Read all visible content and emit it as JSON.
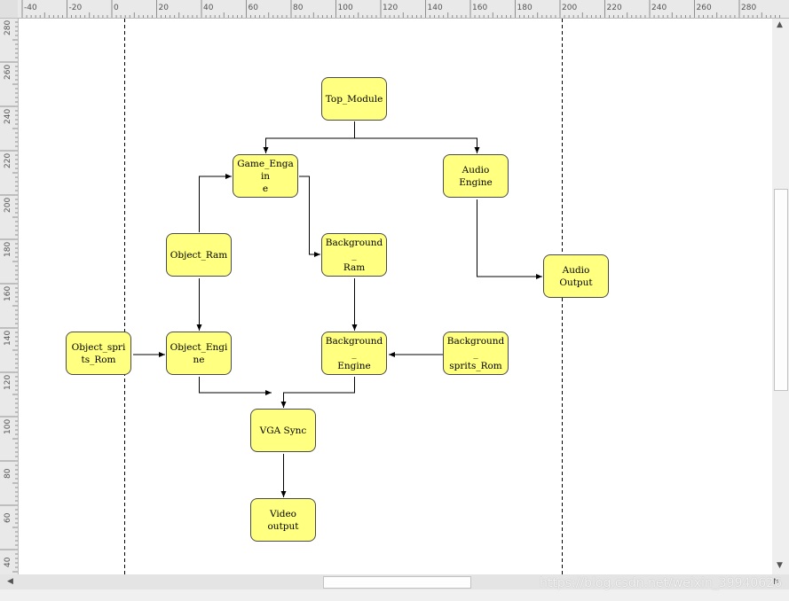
{
  "nodes": {
    "top_module": "Top_Module",
    "game_engine": "Game_Engain\ne",
    "audio_engine": "Audio\nEngine",
    "object_ram": "Object_Ram",
    "background_ram": "Background_\nRam",
    "audio_output": "Audio\nOutput",
    "object_sprits_rom": "Object_spri\nts_Rom",
    "object_engine": "Object_Engi\nne",
    "background_engine": "Background_\nEngine",
    "background_sprits_rom": "Background_\nsprits_Rom",
    "vga_sync": "VGA Sync",
    "video_output": "Video\noutput"
  },
  "rulers": {
    "horizontal_labels": [
      "-40",
      "-20",
      "0",
      "20",
      "40",
      "60",
      "80",
      "100",
      "120",
      "140",
      "160",
      "180",
      "200",
      "220",
      "240",
      "260",
      "280"
    ],
    "vertical_labels": [
      "280",
      "260",
      "240",
      "220",
      "200",
      "180",
      "160",
      "140",
      "120",
      "100",
      "80",
      "60",
      "40"
    ]
  },
  "watermark": "https://blog.csdn.net/weixin_39940626"
}
